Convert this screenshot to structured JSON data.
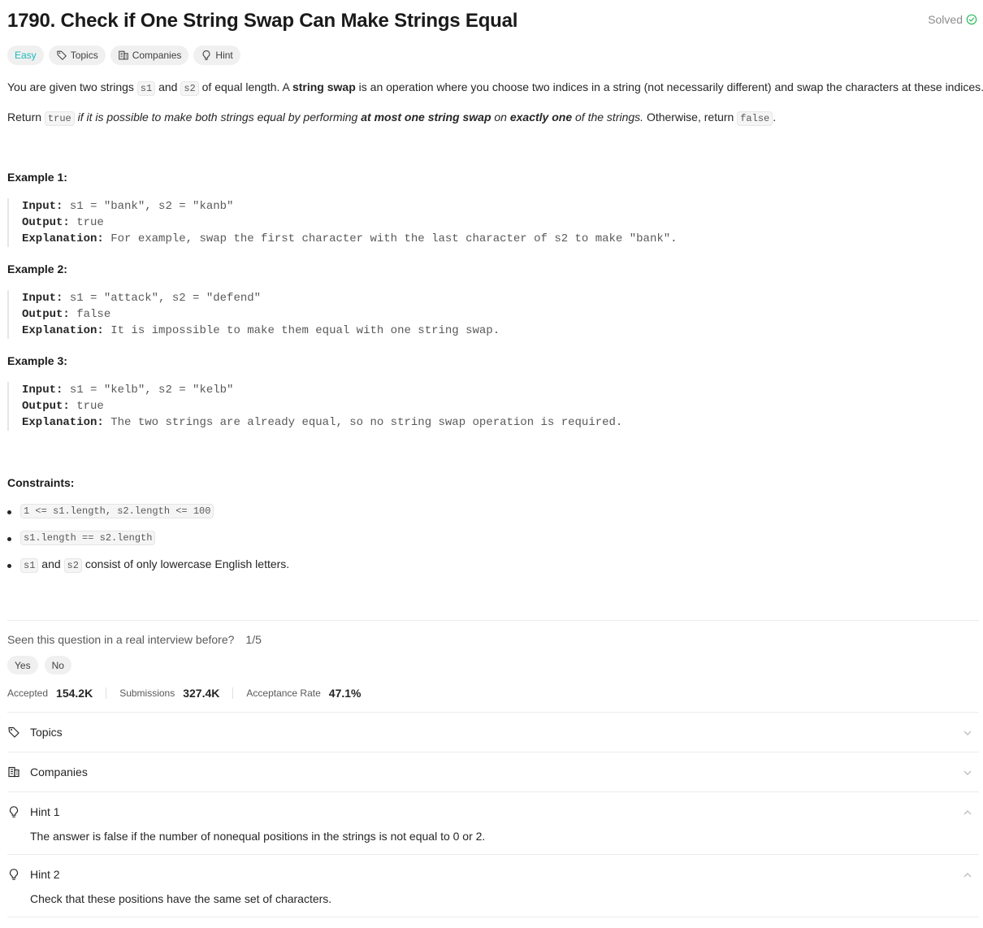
{
  "problem": {
    "title": "1790. Check if One String Swap Can Make Strings Equal",
    "status": "Solved",
    "tags": {
      "difficulty": "Easy",
      "topics": "Topics",
      "companies": "Companies",
      "hint": "Hint"
    }
  },
  "description": {
    "p1": {
      "a": "You are given two strings ",
      "c1": "s1",
      "b": " and ",
      "c2": "s2",
      "c": " of equal length. A ",
      "bold": "string swap",
      "d": " is an operation where you choose two indices in a string (not necessarily different) and swap the characters at these indices."
    },
    "p2": {
      "a": "Return ",
      "c1": "true",
      "i1": " if it is possible to make both strings equal by performing ",
      "b1": "at most one string swap",
      "i2": " on ",
      "b2": "exactly one",
      "i3": " of the strings.",
      "b": " Otherwise, return ",
      "c2": "false",
      "c": "."
    }
  },
  "examples": [
    {
      "heading": "Example 1:",
      "input_label": "Input:",
      "input": " s1 = \"bank\", s2 = \"kanb\"",
      "output_label": "Output:",
      "output": " true",
      "explanation_label": "Explanation:",
      "explanation": " For example, swap the first character with the last character of s2 to make \"bank\"."
    },
    {
      "heading": "Example 2:",
      "input_label": "Input:",
      "input": " s1 = \"attack\", s2 = \"defend\"",
      "output_label": "Output:",
      "output": " false",
      "explanation_label": "Explanation:",
      "explanation": " It is impossible to make them equal with one string swap."
    },
    {
      "heading": "Example 3:",
      "input_label": "Input:",
      "input": " s1 = \"kelb\", s2 = \"kelb\"",
      "output_label": "Output:",
      "output": " true",
      "explanation_label": "Explanation:",
      "explanation": " The two strings are already equal, so no string swap operation is required."
    }
  ],
  "constraints": {
    "heading": "Constraints:",
    "c1": "1 <= s1.length, s2.length <= 100",
    "c2": "s1.length == s2.length",
    "c3a": "s1",
    "c3b": " and ",
    "c3c": "s2",
    "c3d": " consist of only lowercase English letters."
  },
  "interview": {
    "question": "Seen this question in a real interview before?",
    "count": "1/5",
    "yes": "Yes",
    "no": "No"
  },
  "stats": {
    "accepted_label": "Accepted",
    "accepted": "154.2K",
    "submissions_label": "Submissions",
    "submissions": "327.4K",
    "rate_label": "Acceptance Rate",
    "rate": "47.1%"
  },
  "sections": {
    "topics": "Topics",
    "companies": "Companies",
    "hint1_title": "Hint 1",
    "hint1_text": "The answer is false if the number of nonequal positions in the strings is not equal to 0 or 2.",
    "hint2_title": "Hint 2",
    "hint2_text": "Check that these positions have the same set of characters."
  },
  "colors": {
    "easy": "#1cbaba",
    "solved_check": "#2cbb5d"
  }
}
